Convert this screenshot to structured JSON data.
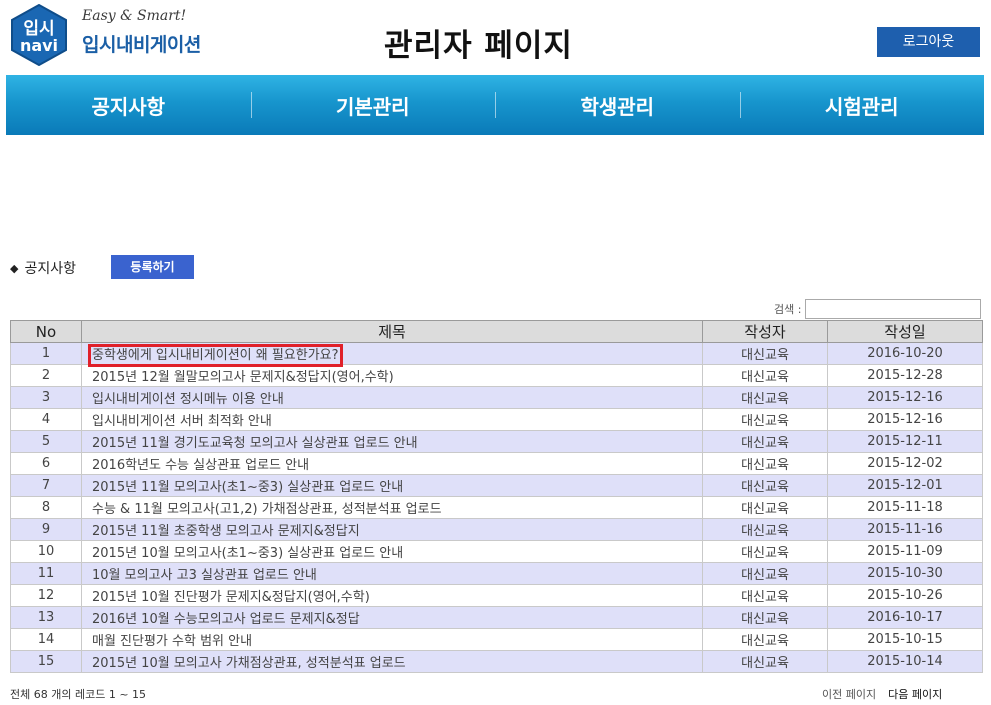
{
  "logo": {
    "badge_top": "입시",
    "badge_bottom": "navi",
    "tagline": "Easy & Smart!",
    "name": "입시내비게이션"
  },
  "header": {
    "title": "관리자 페이지",
    "logout_label": "로그아웃"
  },
  "nav": {
    "items": [
      {
        "label": "공지사항"
      },
      {
        "label": "기본관리"
      },
      {
        "label": "학생관리"
      },
      {
        "label": "시험관리"
      }
    ]
  },
  "section": {
    "title": "공지사항",
    "register_label": "등록하기"
  },
  "search": {
    "label": "검색 :",
    "value": ""
  },
  "table": {
    "columns": [
      "No",
      "제목",
      "작성자",
      "작성일"
    ],
    "rows": [
      {
        "no": "1",
        "title": "중학생에게 입시내비게이션이 왜 필요한가요?",
        "author": "대신교육",
        "date": "2016-10-20"
      },
      {
        "no": "2",
        "title": "2015년 12월 월말모의고사 문제지&정답지(영어,수학)",
        "author": "대신교육",
        "date": "2015-12-28"
      },
      {
        "no": "3",
        "title": "입시내비게이션 정시메뉴 이용 안내",
        "author": "대신교육",
        "date": "2015-12-16"
      },
      {
        "no": "4",
        "title": "입시내비게이션 서버 최적화 안내",
        "author": "대신교육",
        "date": "2015-12-16"
      },
      {
        "no": "5",
        "title": "2015년 11월 경기도교육청 모의고사 실상관표 업로드 안내",
        "author": "대신교육",
        "date": "2015-12-11"
      },
      {
        "no": "6",
        "title": "2016학년도 수능 실상관표 업로드 안내",
        "author": "대신교육",
        "date": "2015-12-02"
      },
      {
        "no": "7",
        "title": "2015년 11월 모의고사(초1~중3) 실상관표 업로드 안내",
        "author": "대신교육",
        "date": "2015-12-01"
      },
      {
        "no": "8",
        "title": "수능 & 11월 모의고사(고1,2) 가채점상관표, 성적분석표 업로드",
        "author": "대신교육",
        "date": "2015-11-18"
      },
      {
        "no": "9",
        "title": "2015년 11월 초중학생 모의고사 문제지&정답지",
        "author": "대신교육",
        "date": "2015-11-16"
      },
      {
        "no": "10",
        "title": "2015년 10월 모의고사(초1~중3) 실상관표 업로드 안내",
        "author": "대신교육",
        "date": "2015-11-09"
      },
      {
        "no": "11",
        "title": "10월 모의고사 고3 실상관표 업로드 안내",
        "author": "대신교육",
        "date": "2015-10-30"
      },
      {
        "no": "12",
        "title": "2015년 10월 진단평가 문제지&정답지(영어,수학)",
        "author": "대신교육",
        "date": "2015-10-26"
      },
      {
        "no": "13",
        "title": "2016년 10월 수능모의고사 업로드 문제지&정답",
        "author": "대신교육",
        "date": "2016-10-17"
      },
      {
        "no": "14",
        "title": "매월 진단평가 수학 범위 안내",
        "author": "대신교육",
        "date": "2015-10-15"
      },
      {
        "no": "15",
        "title": "2015년 10월 모의고사 가채점상관표, 성적분석표 업로드",
        "author": "대신교육",
        "date": "2015-10-14"
      }
    ]
  },
  "footer": {
    "record_count": "전체 68 개의 레코드 1 ~ 15",
    "prev_label": "이전 페이지",
    "next_label": "다음 페이지"
  },
  "colors": {
    "nav_bg": "#1795cd",
    "logout_bg": "#1e5fae",
    "register_bg": "#3a63cf",
    "odd_row": "#dfe0f9",
    "highlight": "#e0202a"
  }
}
